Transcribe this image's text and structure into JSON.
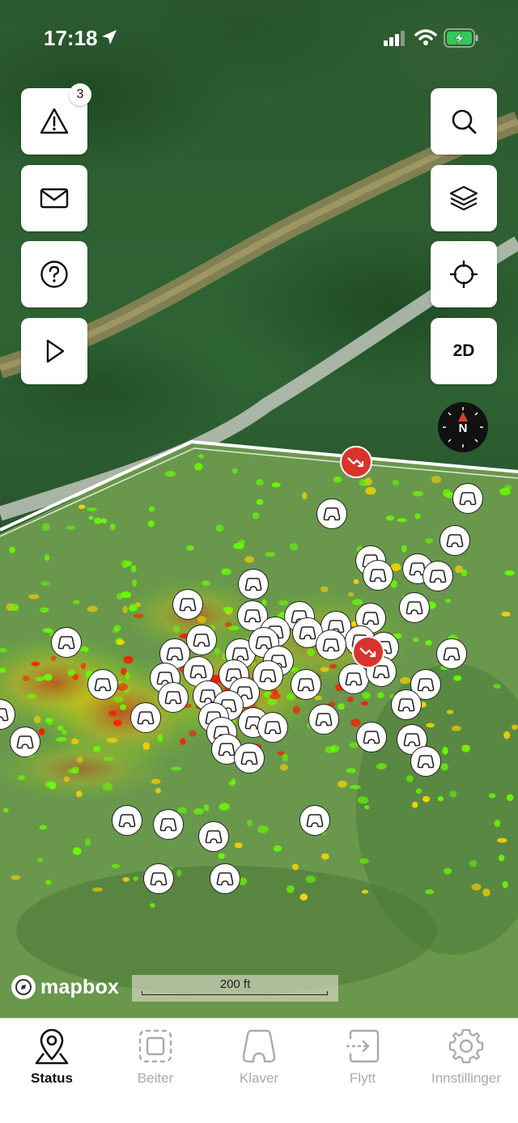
{
  "status_bar": {
    "time": "17:18"
  },
  "map_controls": {
    "alerts_badge": "3",
    "mode_toggle_label": "2D",
    "compass_label": "N"
  },
  "attribution": {
    "logo_text": "mapbox",
    "scale_label": "200 ft"
  },
  "tabs": [
    {
      "label": "Status",
      "icon": "location-pin-icon",
      "active": true
    },
    {
      "label": "Beiter",
      "icon": "area-icon",
      "active": false
    },
    {
      "label": "Klaver",
      "icon": "bell-collar-icon",
      "active": false
    },
    {
      "label": "Flytt",
      "icon": "move-icon",
      "active": false
    },
    {
      "label": "Innstillinger",
      "icon": "gear-icon",
      "active": false
    }
  ],
  "colors": {
    "heat_low": "#66ff00",
    "heat_mid": "#ffd400",
    "heat_high": "#ff1a00",
    "alert_marker": "#d9342b"
  }
}
